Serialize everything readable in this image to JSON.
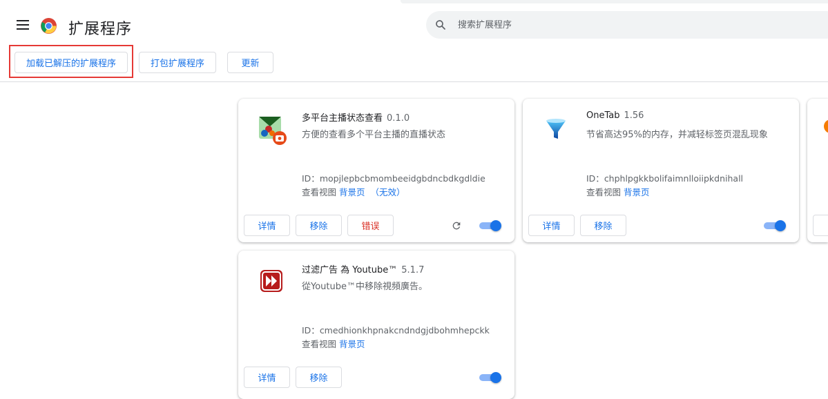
{
  "header": {
    "title": "扩展程序",
    "search_placeholder": "搜索扩展程序"
  },
  "toolbar": {
    "load_unpacked": "加载已解压的扩展程序",
    "pack": "打包扩展程序",
    "update": "更新"
  },
  "colors": {
    "accent": "#1a73e8",
    "error": "#d93025",
    "highlight_box": "#e53935"
  },
  "cards": [
    {
      "name": "多平台主播状态查看",
      "version": "0.1.0",
      "description": "方便的查看多个平台主播的直播状态",
      "id_label": "ID：",
      "id": "mopjlepbcbmombeeidgbdncbdkgdldie",
      "views_label": "查看视图",
      "view_link": "背景页",
      "view_suffix": "（无效）",
      "details": "详情",
      "remove": "移除",
      "errors": "错误",
      "icon": "streamer-extension-icon",
      "enabled": true
    },
    {
      "name": "OneTab",
      "version": "1.56",
      "description": "节省高达95%的内存，并减轻标签页混乱现象",
      "id_label": "ID：",
      "id": "chphlpgkkbolifaimnlloiipkdnihall",
      "views_label": "查看视图",
      "view_link": "背景页",
      "details": "详情",
      "remove": "移除",
      "icon": "onetab-funnel-icon",
      "enabled": true
    },
    {
      "name": "过滤广告 為 Youtube™",
      "version": "5.1.7",
      "description": "從Youtube™中移除視頻廣告。",
      "id_label": "ID：",
      "id": "cmedhionkhpnakcndndgjdbohmhepckk",
      "views_label": "查看视图",
      "view_link": "背景页",
      "details": "详情",
      "remove": "移除",
      "icon": "fast-forward-icon",
      "enabled": true
    }
  ]
}
